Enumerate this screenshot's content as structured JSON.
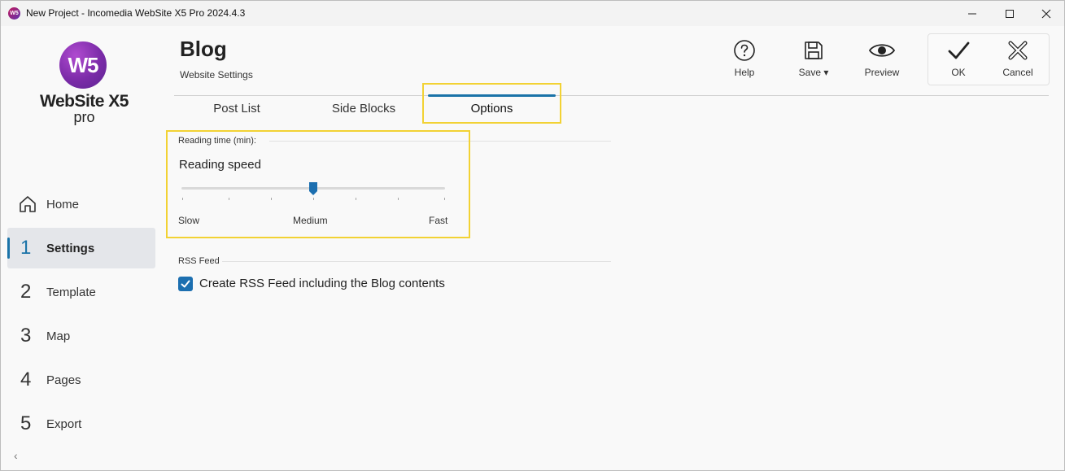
{
  "window": {
    "title": "New Project - Incomedia WebSite X5 Pro 2024.4.3",
    "app_icon_text": "W5"
  },
  "logo": {
    "mark": "W5",
    "name": "WebSite X5",
    "edition": "pro"
  },
  "sidebar": {
    "items": [
      {
        "num": "",
        "label": "Home",
        "icon": "home-icon"
      },
      {
        "num": "1",
        "label": "Settings",
        "active": true
      },
      {
        "num": "2",
        "label": "Template"
      },
      {
        "num": "3",
        "label": "Map"
      },
      {
        "num": "4",
        "label": "Pages"
      },
      {
        "num": "5",
        "label": "Export"
      }
    ],
    "collapse_icon": "chevron-left-icon"
  },
  "header": {
    "title": "Blog",
    "subtitle": "Website Settings"
  },
  "toolbar": {
    "help": "Help",
    "save": "Save ▾",
    "preview": "Preview",
    "ok": "OK",
    "cancel": "Cancel"
  },
  "tabs": [
    {
      "label": "Post List"
    },
    {
      "label": "Side Blocks"
    },
    {
      "label": "Options",
      "active": true
    }
  ],
  "reading_time": {
    "group_label": "Reading time (min):",
    "slider_label": "Reading speed",
    "min_label": "Slow",
    "mid_label": "Medium",
    "max_label": "Fast",
    "value_fraction": 0.5
  },
  "rss": {
    "group_label": "RSS Feed",
    "checkbox_label": "Create RSS Feed including the Blog contents",
    "checked": true
  },
  "colors": {
    "accent": "#1a73a8",
    "highlight": "#f2d234",
    "checkbox": "#1c6fb0"
  }
}
